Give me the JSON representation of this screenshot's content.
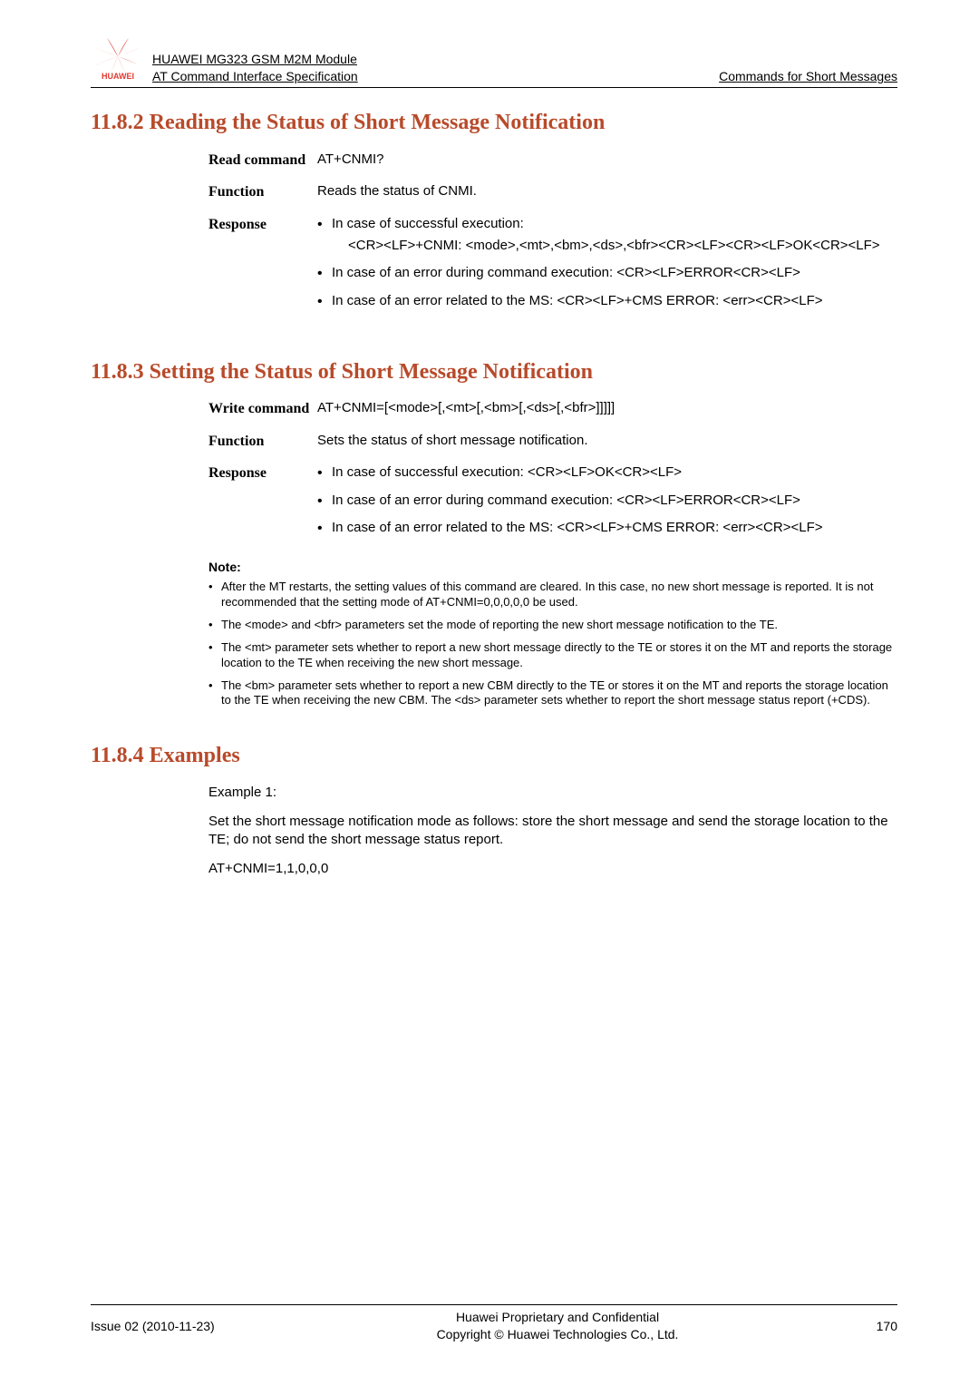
{
  "header": {
    "line1": "HUAWEI MG323 GSM M2M Module",
    "line2": "AT Command Interface Specification",
    "right": "Commands for Short Messages",
    "logo_brand": "HUAWEI"
  },
  "sec1": {
    "heading": "11.8.2 Reading the Status of Short Message Notification",
    "read_label": "Read command",
    "read_value": "AT+CNMI?",
    "function_label": "Function",
    "function_value": "Reads the status of CNMI.",
    "response_label": "Response",
    "resp1_lead": "In case of successful execution:",
    "resp1_body": "<CR><LF>+CNMI: <mode>,<mt>,<bm>,<ds>,<bfr><CR><LF><CR><LF>OK<CR><LF>",
    "resp2": "In case of an error during command execution: <CR><LF>ERROR<CR><LF>",
    "resp3": "In case of an error related to the MS: <CR><LF>+CMS ERROR: <err><CR><LF>"
  },
  "sec2": {
    "heading": "11.8.3 Setting the Status of Short Message Notification",
    "write_label": "Write command",
    "write_value": "AT+CNMI=[<mode>[,<mt>[,<bm>[,<ds>[,<bfr>]]]]]",
    "function_label": "Function",
    "function_value": "Sets the status of short message notification.",
    "response_label": "Response",
    "resp1": "In case of successful execution:   <CR><LF>OK<CR><LF>",
    "resp2": "In case of an error during command execution: <CR><LF>ERROR<CR><LF>",
    "resp3": "In case of an error related to the MS: <CR><LF>+CMS ERROR: <err><CR><LF>",
    "note_title": "Note:",
    "note1": "After the MT restarts, the setting values of this command are cleared. In this case, no new short message is reported. It is not recommended that the setting mode of AT+CNMI=0,0,0,0,0 be used.",
    "note2": "The <mode> and <bfr> parameters set the mode of reporting the new short message notification to the TE.",
    "note3": "The <mt> parameter sets whether to report a new short message directly to the TE or stores it on the MT and reports the storage location to the TE when receiving the new short message.",
    "note4": "The <bm> parameter sets whether to report a new CBM directly to the TE or stores it on the MT and reports the storage location to the TE when receiving the new CBM. The <ds> parameter sets whether to report the short message status report (+CDS)."
  },
  "sec3": {
    "heading": "11.8.4 Examples",
    "ex_label": "Example 1:",
    "ex_body": "Set the short message notification mode as follows: store the short message and send the storage location to the TE; do not send the short message status report.",
    "ex_cmd": "AT+CNMI=1,1,0,0,0"
  },
  "footer": {
    "left": "Issue 02 (2010-11-23)",
    "mid1": "Huawei Proprietary and Confidential",
    "mid2": "Copyright © Huawei Technologies Co., Ltd.",
    "right": "170"
  }
}
